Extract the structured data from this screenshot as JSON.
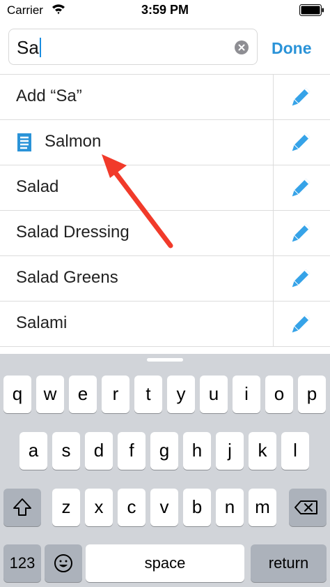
{
  "status_bar": {
    "carrier": "Carrier",
    "time": "3:59 PM"
  },
  "search": {
    "value": "Sa",
    "done_label": "Done"
  },
  "list_items": [
    {
      "label": "Add “Sa”",
      "has_food_icon": false
    },
    {
      "label": "Salmon",
      "has_food_icon": true
    },
    {
      "label": "Salad",
      "has_food_icon": false
    },
    {
      "label": "Salad Dressing",
      "has_food_icon": false
    },
    {
      "label": "Salad Greens",
      "has_food_icon": false
    },
    {
      "label": "Salami",
      "has_food_icon": false
    }
  ],
  "keyboard": {
    "row1": [
      "q",
      "w",
      "e",
      "r",
      "t",
      "y",
      "u",
      "i",
      "o",
      "p"
    ],
    "row2": [
      "a",
      "s",
      "d",
      "f",
      "g",
      "h",
      "j",
      "k",
      "l"
    ],
    "row3": [
      "z",
      "x",
      "c",
      "v",
      "b",
      "n",
      "m"
    ],
    "numbers_label": "123",
    "space_label": "space",
    "return_label": "return"
  },
  "colors": {
    "accent": "#2a93d8",
    "arrow": "#f13a2a",
    "keyboard_bg": "#d1d4d9"
  }
}
